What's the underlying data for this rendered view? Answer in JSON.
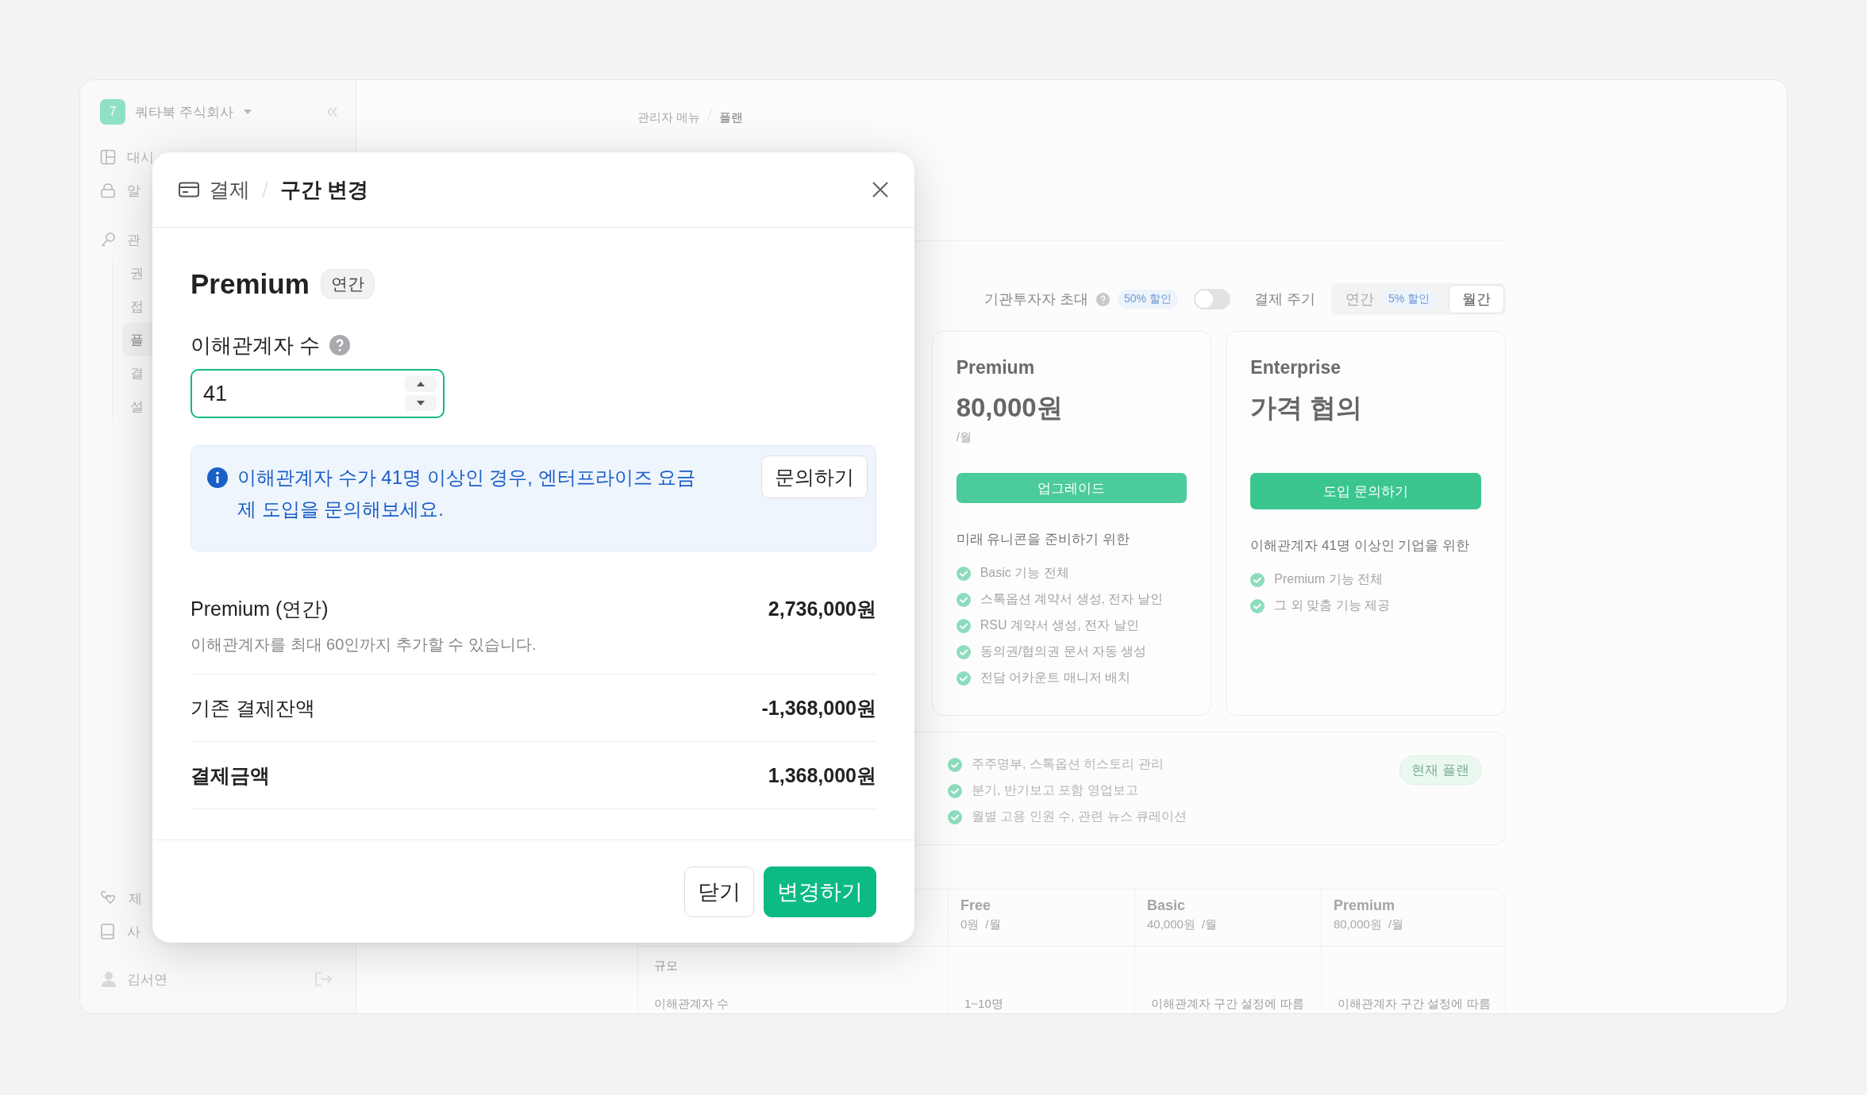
{
  "sidebar": {
    "company": {
      "logo": "7",
      "name": "쿼타북 주식회사"
    },
    "items": [
      {
        "label": "대시",
        "selected": false
      },
      {
        "label": "알",
        "selected": false
      }
    ],
    "admin_section": {
      "label": "관",
      "children": [
        {
          "label": "권",
          "selected": false
        },
        {
          "label": "접",
          "selected": false
        },
        {
          "label": "플",
          "selected": true
        },
        {
          "label": "결",
          "selected": false
        },
        {
          "label": "설",
          "selected": false
        }
      ]
    },
    "footer_items": [
      {
        "label": "제"
      },
      {
        "label": "사"
      }
    ],
    "user": {
      "name": "김서연"
    }
  },
  "breadcrumb": [
    "관리자 메뉴",
    "플랜"
  ],
  "filters": {
    "investor_invite": {
      "label": "기관투자자 초대",
      "badge": "50% 할인",
      "on": false
    },
    "billing_cycle": {
      "label": "결제 주기",
      "options": [
        {
          "label": "연간",
          "badge": "5% 할인",
          "selected": false
        },
        {
          "label": "월간",
          "selected": true
        }
      ]
    }
  },
  "plans": [
    {
      "name": "Premium",
      "price": "80,000원",
      "period": "/월",
      "button": "업그레이드",
      "subtitle": "미래 유니콘을 준비하기 위한",
      "features": [
        "Basic 기능 전체",
        "스톡옵션 계약서 생성, 전자 날인",
        "RSU 계약서 생성, 전자 날인",
        "동의권/협의권 문서 자동 생성",
        "전담 어카운트 매니저 배치"
      ]
    },
    {
      "name": "Enterprise",
      "price": "가격 협의",
      "button": "도입 문의하기",
      "subtitle": "이해관계자 41명 이상인 기업을 위한",
      "features": [
        "Premium 기능 전체",
        "그 외 맞춤 기능 제공"
      ]
    }
  ],
  "current_plan": {
    "features": [
      "주주명부, 스톡옵션 히스토리 관리",
      "분기, 반기보고 포함 영업보고",
      "월별 고용 인원 수, 관련 뉴스 큐레이션"
    ],
    "badge": "현재 플랜"
  },
  "comparison_table": {
    "columns": [
      {
        "name": "Free",
        "price": "0원",
        "period": "/월"
      },
      {
        "name": "Basic",
        "price": "40,000원",
        "period": "/월"
      },
      {
        "name": "Premium",
        "price": "80,000원",
        "period": "/월"
      }
    ],
    "section": "규모",
    "rows": [
      {
        "label": "이해관계자 수",
        "cells": [
          "1~10명",
          "이해관계자 구간 설정에 따름",
          "이해관계자 구간 설정에 따름"
        ]
      }
    ]
  },
  "dialog": {
    "breadcrumb": [
      "결제",
      "구간 변경"
    ],
    "plan": "Premium",
    "plan_badge": "연간",
    "field": {
      "label": "이해관계자 수",
      "value": "41"
    },
    "notice": {
      "text": "이해관계자 수가 41명 이상인 경우, 엔터프라이즈 요금제 도입을 문의해보세요.",
      "button": "문의하기"
    },
    "lines": [
      {
        "label": "Premium (연간)",
        "amount": "2,736,000원",
        "note": "이해관계자를 최대 60인까지 추가할 수 있습니다.",
        "kind": "item"
      },
      {
        "label": "기존 결제잔액",
        "amount": "-1,368,000원",
        "kind": "item"
      },
      {
        "label": "결제금액",
        "amount": "1,368,000원",
        "kind": "total"
      }
    ],
    "buttons": [
      {
        "label": "닫기",
        "kind": "secondary"
      },
      {
        "label": "변경하기",
        "kind": "primary"
      }
    ]
  }
}
